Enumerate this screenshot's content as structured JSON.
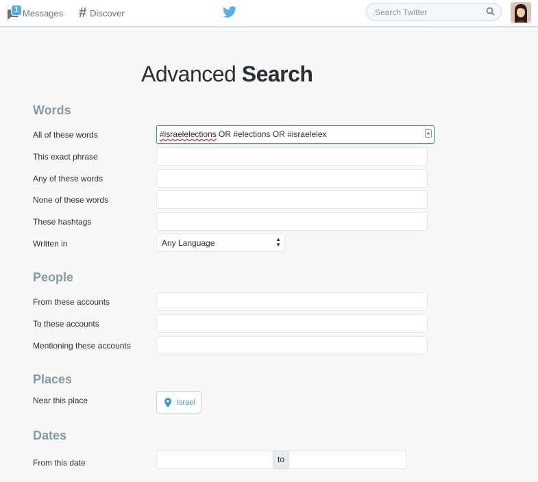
{
  "header": {
    "messages_label": "Messages",
    "messages_badge": "1",
    "discover_label": "Discover",
    "search_placeholder": "Search Twitter",
    "brand_icon": "twitter-bird-icon",
    "brand_color": "#55acee"
  },
  "page": {
    "title_light": "Advanced ",
    "title_bold": "Search"
  },
  "words": {
    "section": "Words",
    "all_label": "All of these words",
    "all_value_part1": "#israelelections",
    "all_value_part2": " OR #elections OR #israelelex",
    "exact_label": "This exact phrase",
    "any_label": "Any of these words",
    "none_label": "None of these words",
    "hashtags_label": "These hashtags",
    "language_label": "Written in",
    "language_value": "Any Language"
  },
  "people": {
    "section": "People",
    "from_label": "From these accounts",
    "to_label": "To these accounts",
    "mentioning_label": "Mentioning these accounts"
  },
  "places": {
    "section": "Places",
    "near_label": "Near this place",
    "place_value": "Israel"
  },
  "dates": {
    "section": "Dates",
    "from_label": "From this date",
    "to_label": "to"
  }
}
